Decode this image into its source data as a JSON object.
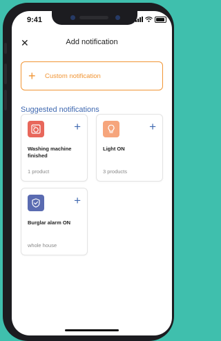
{
  "status_bar": {
    "time": "9:41"
  },
  "header": {
    "close_icon": "close-icon",
    "title": "Add notification"
  },
  "custom": {
    "plus_icon": "plus-icon",
    "label": "Custom notification",
    "color": "#f19433"
  },
  "suggested": {
    "heading": "Suggested notifications",
    "heading_color": "#3f68b0",
    "cards": [
      {
        "icon": "washing-machine-icon",
        "icon_bg": "#e8675b",
        "title": "Washing machine finished",
        "subtitle": "1 product"
      },
      {
        "icon": "lightbulb-icon",
        "icon_bg": "#f6a57c",
        "title": "Light ON",
        "subtitle": "3 products"
      },
      {
        "icon": "shield-check-icon",
        "icon_bg": "#5a6bb1",
        "title": "Burglar alarm ON",
        "subtitle": "whole house"
      }
    ]
  }
}
